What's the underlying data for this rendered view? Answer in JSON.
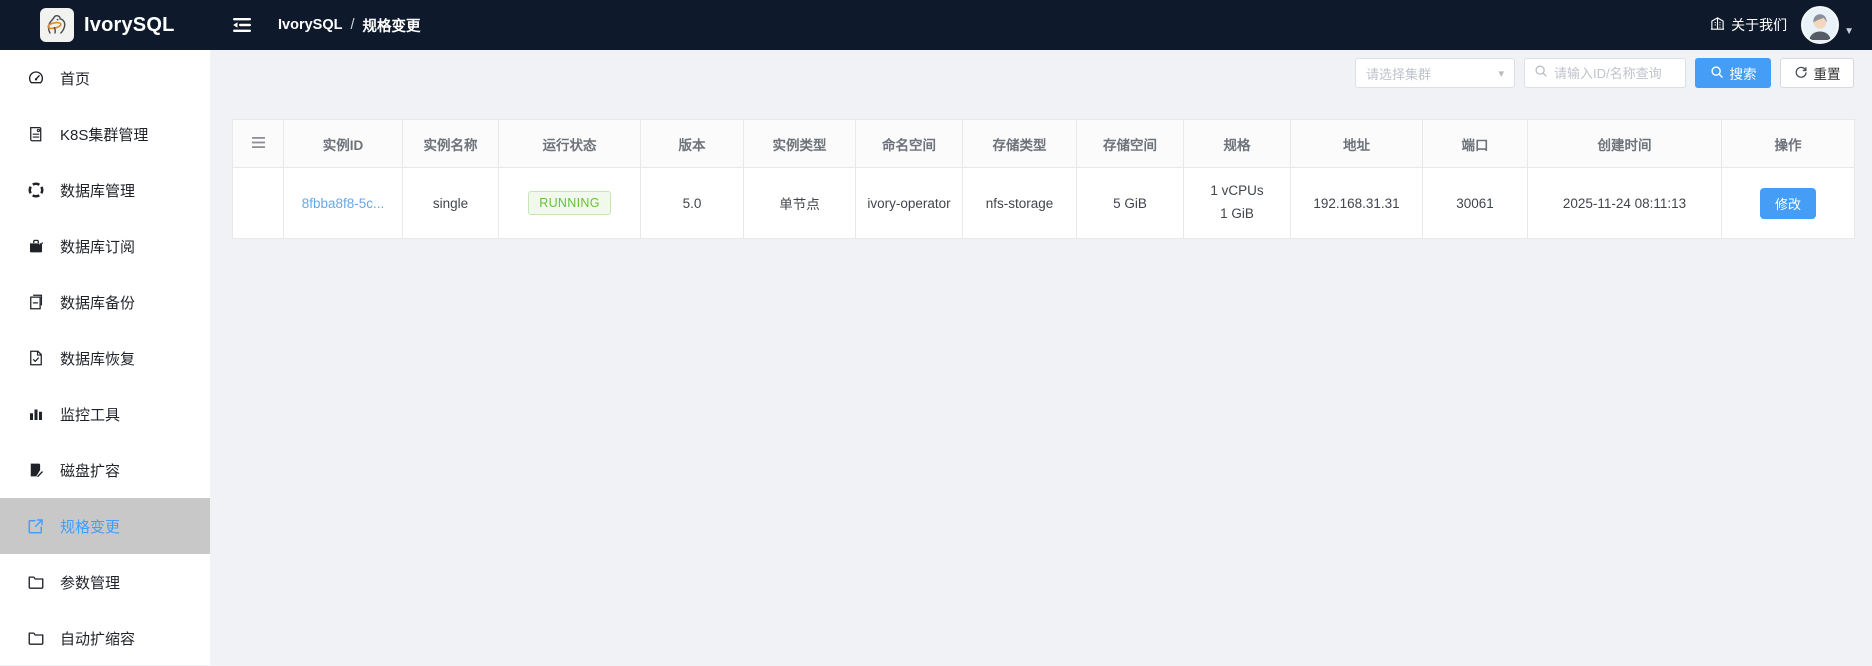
{
  "topbar": {
    "brand": "IvorySQL",
    "breadcrumb": {
      "root": "IvorySQL",
      "separator": "/",
      "current": "规格变更"
    },
    "about_label": "关于我们",
    "icons": [
      "ivorysql-logo",
      "menu-fold-icon",
      "building-icon",
      "avatar",
      "chevron-down-icon"
    ]
  },
  "sidebar": {
    "items": [
      {
        "label": "首页",
        "icon": "dashboard-icon",
        "active": false
      },
      {
        "label": "K8S集群管理",
        "icon": "profile-icon",
        "active": false
      },
      {
        "label": "数据库管理",
        "icon": "deployment-icon",
        "active": false
      },
      {
        "label": "数据库订阅",
        "icon": "briefcase-icon",
        "active": false
      },
      {
        "label": "数据库备份",
        "icon": "file-minus-icon",
        "active": false
      },
      {
        "label": "数据库恢复",
        "icon": "file-check-icon",
        "active": false
      },
      {
        "label": "监控工具",
        "icon": "bar-chart-icon",
        "active": false
      },
      {
        "label": "磁盘扩容",
        "icon": "file-edit-icon",
        "active": false
      },
      {
        "label": "规格变更",
        "icon": "external-link-icon",
        "active": true
      },
      {
        "label": "参数管理",
        "icon": "folder-icon",
        "active": false
      },
      {
        "label": "自动扩缩容",
        "icon": "folder-icon",
        "active": false
      }
    ],
    "active_color": "#409eff",
    "active_bg": "#c8c8c8"
  },
  "filters": {
    "cluster_placeholder": "请选择集群",
    "search_placeholder": "请输入ID/名称查询",
    "search_label": "搜索",
    "reset_label": "重置"
  },
  "table": {
    "columns": [
      "实例ID",
      "实例名称",
      "运行状态",
      "版本",
      "实例类型",
      "命名空间",
      "存储类型",
      "存储空间",
      "规格",
      "地址",
      "端口",
      "创建时间",
      "操作"
    ],
    "rows": [
      {
        "instance_id": "8fbba8f8-5c...",
        "name": "single",
        "status": "RUNNING",
        "version": "5.0",
        "type": "单节点",
        "namespace": "ivory-operator",
        "storage_type": "nfs-storage",
        "storage_size": "5 GiB",
        "spec_cpu": "1 vCPUs",
        "spec_mem": "1 GiB",
        "address": "192.168.31.31",
        "port": "30061",
        "created_at": "2025-11-24 08:11:13",
        "action_label": "修改"
      }
    ]
  },
  "colors": {
    "topbar_bg": "#0e1a2b",
    "primary": "#459df5",
    "link": "#66a9e5",
    "status_running_text": "#67c23a",
    "status_running_bg": "#f0f9eb",
    "main_bg": "#f0f2f5",
    "table_border": "#e8e8e8"
  }
}
